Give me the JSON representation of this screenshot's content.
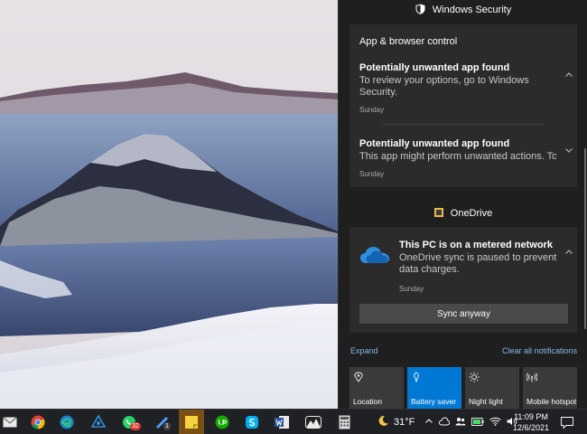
{
  "security_group": {
    "app_name": "Windows Security",
    "card_title": "App & browser control",
    "notifications": [
      {
        "title": "Potentially unwanted app found",
        "body": "To review your options, go to Windows Security.",
        "time": "Sunday"
      },
      {
        "title": "Potentially unwanted app found",
        "body": "This app might perform unwanted actions. To r",
        "time": "Sunday"
      }
    ]
  },
  "onedrive_group": {
    "app_name": "OneDrive",
    "notification": {
      "title": "This PC is on a metered network",
      "body": "OneDrive sync is paused to prevent data charges.",
      "time": "Sunday",
      "action_label": "Sync anyway"
    }
  },
  "action_links": {
    "expand": "Expand",
    "clear_all": "Clear all notifications"
  },
  "quick_actions": [
    {
      "label": "Location",
      "icon": "location-icon",
      "active": false
    },
    {
      "label": "Battery saver",
      "icon": "battery-saver-icon",
      "active": true
    },
    {
      "label": "Night light",
      "icon": "night-light-icon",
      "active": false
    },
    {
      "label": "Mobile hotspot",
      "icon": "mobile-hotspot-icon",
      "active": false
    }
  ],
  "taskbar": {
    "apps": [
      {
        "name": "mail-icon"
      },
      {
        "name": "chrome-icon"
      },
      {
        "name": "edge-icon"
      },
      {
        "name": "app-icon"
      },
      {
        "name": "whatsapp-icon",
        "badge": "32"
      },
      {
        "name": "app-icon",
        "badge": "1"
      },
      {
        "name": "sticky-notes-icon"
      },
      {
        "name": "upwork-icon"
      },
      {
        "name": "skype-icon"
      },
      {
        "name": "word-icon"
      },
      {
        "name": "app-icon"
      },
      {
        "name": "calculator-icon"
      }
    ],
    "weather": {
      "temperature": "31°F",
      "icon": "moon-icon"
    },
    "clock": {
      "time": "11:09 PM",
      "date": "12/6/2021"
    }
  },
  "colors": {
    "panel_bg": "#1f1f1f",
    "card_bg": "#2b2b2b",
    "accent": "#0078d4",
    "link": "#86b8e8",
    "taskbar_bg": "#202124",
    "active_app": "#7a4f14"
  }
}
